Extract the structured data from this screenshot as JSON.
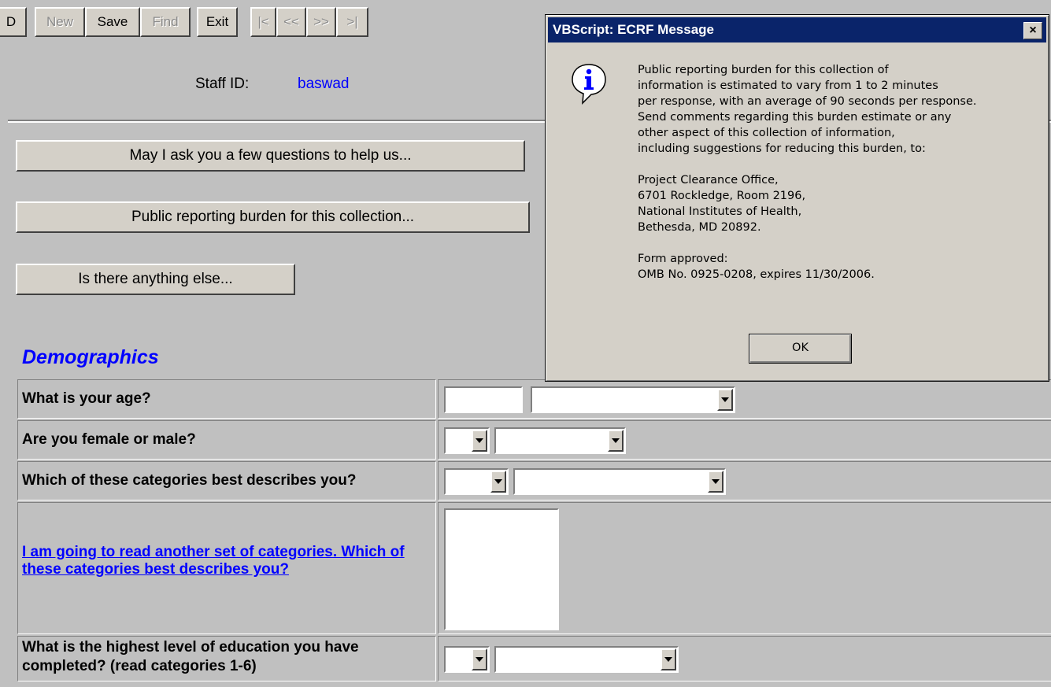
{
  "toolbar": {
    "partial_label": "D",
    "buttons": [
      {
        "label": "New",
        "enabled": false
      },
      {
        "label": "Save",
        "enabled": true
      },
      {
        "label": "Find",
        "enabled": false
      },
      {
        "label": "Exit",
        "enabled": true
      },
      {
        "label": "|<",
        "enabled": false
      },
      {
        "label": "<<",
        "enabled": false
      },
      {
        "label": ">>",
        "enabled": false
      },
      {
        "label": ">|",
        "enabled": false
      }
    ]
  },
  "staff": {
    "label": "Staff ID:",
    "value": "baswad"
  },
  "script_buttons": [
    "May I ask you a few questions to help us...",
    "Public reporting burden for this collection...",
    "Is there anything else..."
  ],
  "section_title": "Demographics",
  "questions": [
    {
      "label": "What is your age?"
    },
    {
      "label": "Are you female or male?"
    },
    {
      "label": "Which of these categories best describes you?"
    },
    {
      "label": "I am going to read another set of categories. Which of these categories best describes you?",
      "link": true
    },
    {
      "label": "What is the highest level of education you have completed? (read categories 1-6)"
    }
  ],
  "dialog": {
    "title": "VBScript: ECRF Message",
    "close_label": "×",
    "icon": "information-icon",
    "paragraphs": [
      "Public reporting burden for this collection of\ninformation is estimated to vary from 1 to 2 minutes\nper response, with an average of 90 seconds per response.\nSend comments regarding this burden estimate or any\nother aspect of this collection of information,\nincluding suggestions for reducing this burden, to:",
      "Project Clearance Office,\n6701 Rockledge, Room 2196,\nNational Institutes of Health,\nBethesda, MD 20892.",
      "Form approved:\nOMB No. 0925-0208, expires 11/30/2006."
    ],
    "ok_label": "OK"
  },
  "colors": {
    "background": "#c0c0c0",
    "title_bar": "#0a246a",
    "link": "#0000ff"
  }
}
